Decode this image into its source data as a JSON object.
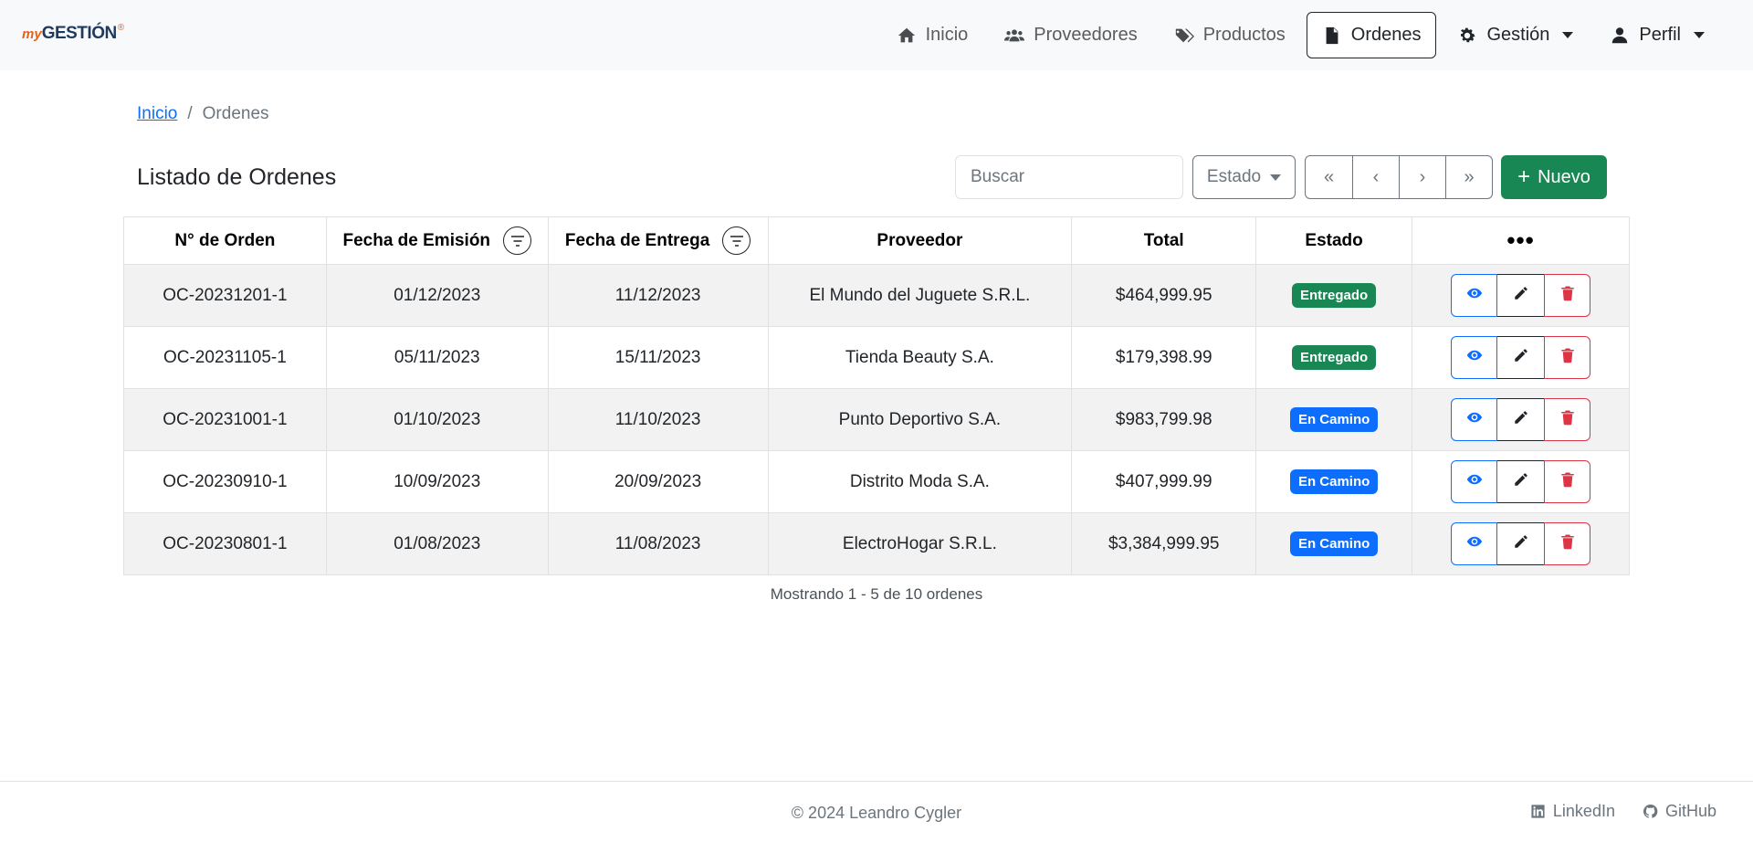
{
  "brand": {
    "prefix": "my",
    "name": "GESTIÓN",
    "mark": "®"
  },
  "nav": [
    {
      "label": "Inicio",
      "icon": "home-icon"
    },
    {
      "label": "Proveedores",
      "icon": "users-icon"
    },
    {
      "label": "Productos",
      "icon": "tags-icon"
    },
    {
      "label": "Ordenes",
      "icon": "file-icon",
      "active": true
    },
    {
      "label": "Gestión",
      "icon": "gear-icon",
      "dropdown": true
    },
    {
      "label": "Perfil",
      "icon": "user-icon",
      "dropdown": true
    }
  ],
  "breadcrumb": {
    "home": "Inicio",
    "separator": "/",
    "current": "Ordenes"
  },
  "page_title": "Listado de Ordenes",
  "search": {
    "placeholder": "Buscar",
    "value": ""
  },
  "estado_filter": {
    "label": "Estado"
  },
  "pager": {
    "first": "«",
    "prev": "‹",
    "next": "›",
    "last": "»"
  },
  "new_button": {
    "icon": "+",
    "label": "Nuevo"
  },
  "table": {
    "headers": [
      "N° de Orden",
      "Fecha de Emisión",
      "Fecha de Entrega",
      "Proveedor",
      "Total",
      "Estado",
      "•••"
    ],
    "rows": [
      {
        "id": "OC-20231201-1",
        "emision": "01/12/2023",
        "entrega": "11/12/2023",
        "proveedor": "El Mundo del Juguete S.R.L.",
        "total": "$464,999.95",
        "estado": "Entregado"
      },
      {
        "id": "OC-20231105-1",
        "emision": "05/11/2023",
        "entrega": "15/11/2023",
        "proveedor": "Tienda Beauty S.A.",
        "total": "$179,398.99",
        "estado": "Entregado"
      },
      {
        "id": "OC-20231001-1",
        "emision": "01/10/2023",
        "entrega": "11/10/2023",
        "proveedor": "Punto Deportivo S.A.",
        "total": "$983,799.98",
        "estado": "En Camino"
      },
      {
        "id": "OC-20230910-1",
        "emision": "10/09/2023",
        "entrega": "20/09/2023",
        "proveedor": "Distrito Moda S.A.",
        "total": "$407,999.99",
        "estado": "En Camino"
      },
      {
        "id": "OC-20230801-1",
        "emision": "01/08/2023",
        "entrega": "11/08/2023",
        "proveedor": "ElectroHogar S.R.L.",
        "total": "$3,384,999.95",
        "estado": "En Camino"
      }
    ]
  },
  "status_colors": {
    "Entregado": "#198754",
    "En Camino": "#0d6efd"
  },
  "summary": "Mostrando 1 - 5 de 10 ordenes",
  "footer": {
    "copyright": "© 2024 Leandro Cygler",
    "links": [
      {
        "label": "LinkedIn",
        "icon": "linkedin-icon"
      },
      {
        "label": "GitHub",
        "icon": "github-icon"
      }
    ]
  }
}
